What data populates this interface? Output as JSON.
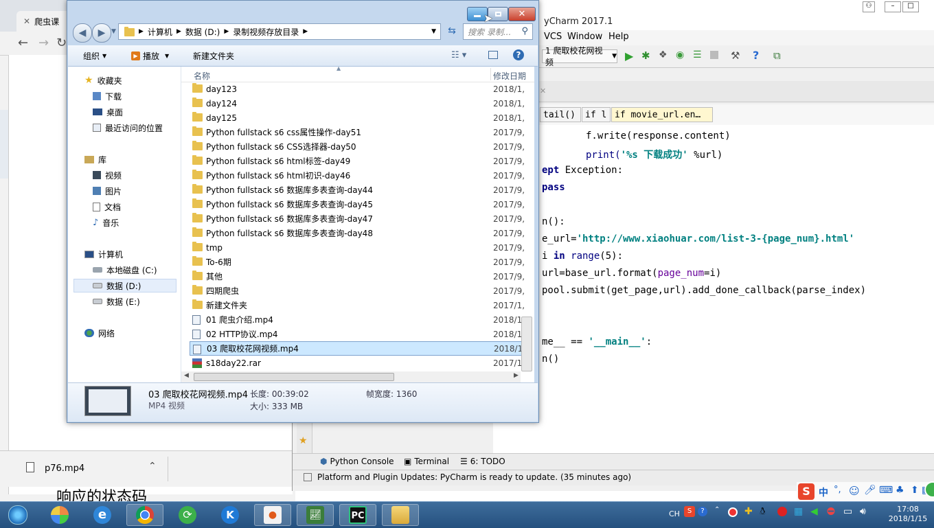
{
  "browser": {
    "tab_title": "爬虫课",
    "download_file": "p76.mp4",
    "page_heading": "响应的状态码"
  },
  "pycharm": {
    "title": "yCharm 2017.1",
    "menu": [
      "VCS",
      "Window",
      "Help"
    ],
    "run_config": "1 爬取校花网视频",
    "crumbs": [
      "tail()",
      "if l",
      "if movie_url.en…"
    ],
    "code": {
      "l1a": "f.write(response.content)",
      "l2a": "print(",
      "l2b": "'%s 下载成功'",
      "l2c": " %url)",
      "l3a": "ept",
      "l3b": " Exception:",
      "l4a": "pass",
      "l5a": "n():",
      "l6a": "e_url=",
      "l6b": "'http://www.xiaohuar.com/list-3-{page_num}.html'",
      "l7a": "i ",
      "l7b": "in",
      "l7c": " range",
      "l7d": "(5):",
      "l8a": "url=base_url.format(",
      "l8b": "page_num",
      "l8c": "=i)",
      "l9a": "pool.submit(get_page,url).add_done_callback(parse_index)",
      "l10a": "me__ == ",
      "l10b": "'__main__'",
      "l10c": ":",
      "l11a": "n()"
    },
    "toolwindows": [
      "Python Console",
      "Terminal",
      "6: TODO"
    ],
    "status": "Platform and Plugin Updates: PyCharm is ready to update. (35 minutes ago)"
  },
  "explorer": {
    "address": [
      "计算机",
      "数据 (D:)",
      "录制视频存放目录"
    ],
    "search_placeholder": "搜索 录制...",
    "commands": {
      "organize": "组织",
      "play": "播放",
      "new_folder": "新建文件夹"
    },
    "nav": {
      "favorites": "收藏夹",
      "downloads": "下载",
      "desktop": "桌面",
      "recent": "最近访问的位置",
      "libraries": "库",
      "videos": "视频",
      "pictures": "图片",
      "documents": "文档",
      "music": "音乐",
      "computer": "计算机",
      "disk_c": "本地磁盘 (C:)",
      "disk_d": "数据 (D:)",
      "disk_e": "数据 (E:)",
      "network": "网络"
    },
    "columns": {
      "name": "名称",
      "modified": "修改日期"
    },
    "files": [
      {
        "name": "day123",
        "date": "2018/1,",
        "type": "folder"
      },
      {
        "name": "day124",
        "date": "2018/1,",
        "type": "folder"
      },
      {
        "name": "day125",
        "date": "2018/1,",
        "type": "folder"
      },
      {
        "name": "Python fullstack s6 css属性操作-day51",
        "date": "2017/9,",
        "type": "folder"
      },
      {
        "name": "Python fullstack s6 CSS选择器-day50",
        "date": "2017/9,",
        "type": "folder"
      },
      {
        "name": "Python fullstack s6 html标签-day49",
        "date": "2017/9,",
        "type": "folder"
      },
      {
        "name": "Python fullstack s6 html初识-day46",
        "date": "2017/9,",
        "type": "folder"
      },
      {
        "name": "Python fullstack s6 数据库多表查询-day44",
        "date": "2017/9,",
        "type": "folder"
      },
      {
        "name": "Python fullstack s6 数据库多表查询-day45",
        "date": "2017/9,",
        "type": "folder"
      },
      {
        "name": "Python fullstack s6 数据库多表查询-day47",
        "date": "2017/9,",
        "type": "folder"
      },
      {
        "name": "Python fullstack s6 数据库多表查询-day48",
        "date": "2017/9,",
        "type": "folder"
      },
      {
        "name": "tmp",
        "date": "2017/9,",
        "type": "folder"
      },
      {
        "name": "To-6期",
        "date": "2017/9,",
        "type": "folder"
      },
      {
        "name": "其他",
        "date": "2017/9,",
        "type": "folder"
      },
      {
        "name": "四期爬虫",
        "date": "2017/9,",
        "type": "folder"
      },
      {
        "name": "新建文件夹",
        "date": "2017/1,",
        "type": "folder"
      },
      {
        "name": "01 爬虫介绍.mp4",
        "date": "2018/1,",
        "type": "file"
      },
      {
        "name": "02 HTTP协议.mp4",
        "date": "2018/1,",
        "type": "file"
      },
      {
        "name": "03 爬取校花网视频.mp4",
        "date": "2018/1,",
        "type": "file",
        "selected": true
      },
      {
        "name": "s18day22.rar",
        "date": "2017/1",
        "type": "rar"
      }
    ],
    "details": {
      "filename": "03 爬取校花网视频.mp4",
      "filetype": "MP4 视频",
      "length": "长度: 00:39:02",
      "size": "大小: 333 MB",
      "frame_width": "帧宽度: 1360"
    }
  },
  "taskbar": {
    "lang": "CH",
    "time": "17:08",
    "date": "2018/1/15"
  },
  "ime": {
    "mode": "中"
  },
  "colors": {
    "explorer_frame": "#c5d8ee",
    "selection": "#cce8ff",
    "taskbar": "#2e5c8a",
    "close_red": "#c9402c"
  }
}
